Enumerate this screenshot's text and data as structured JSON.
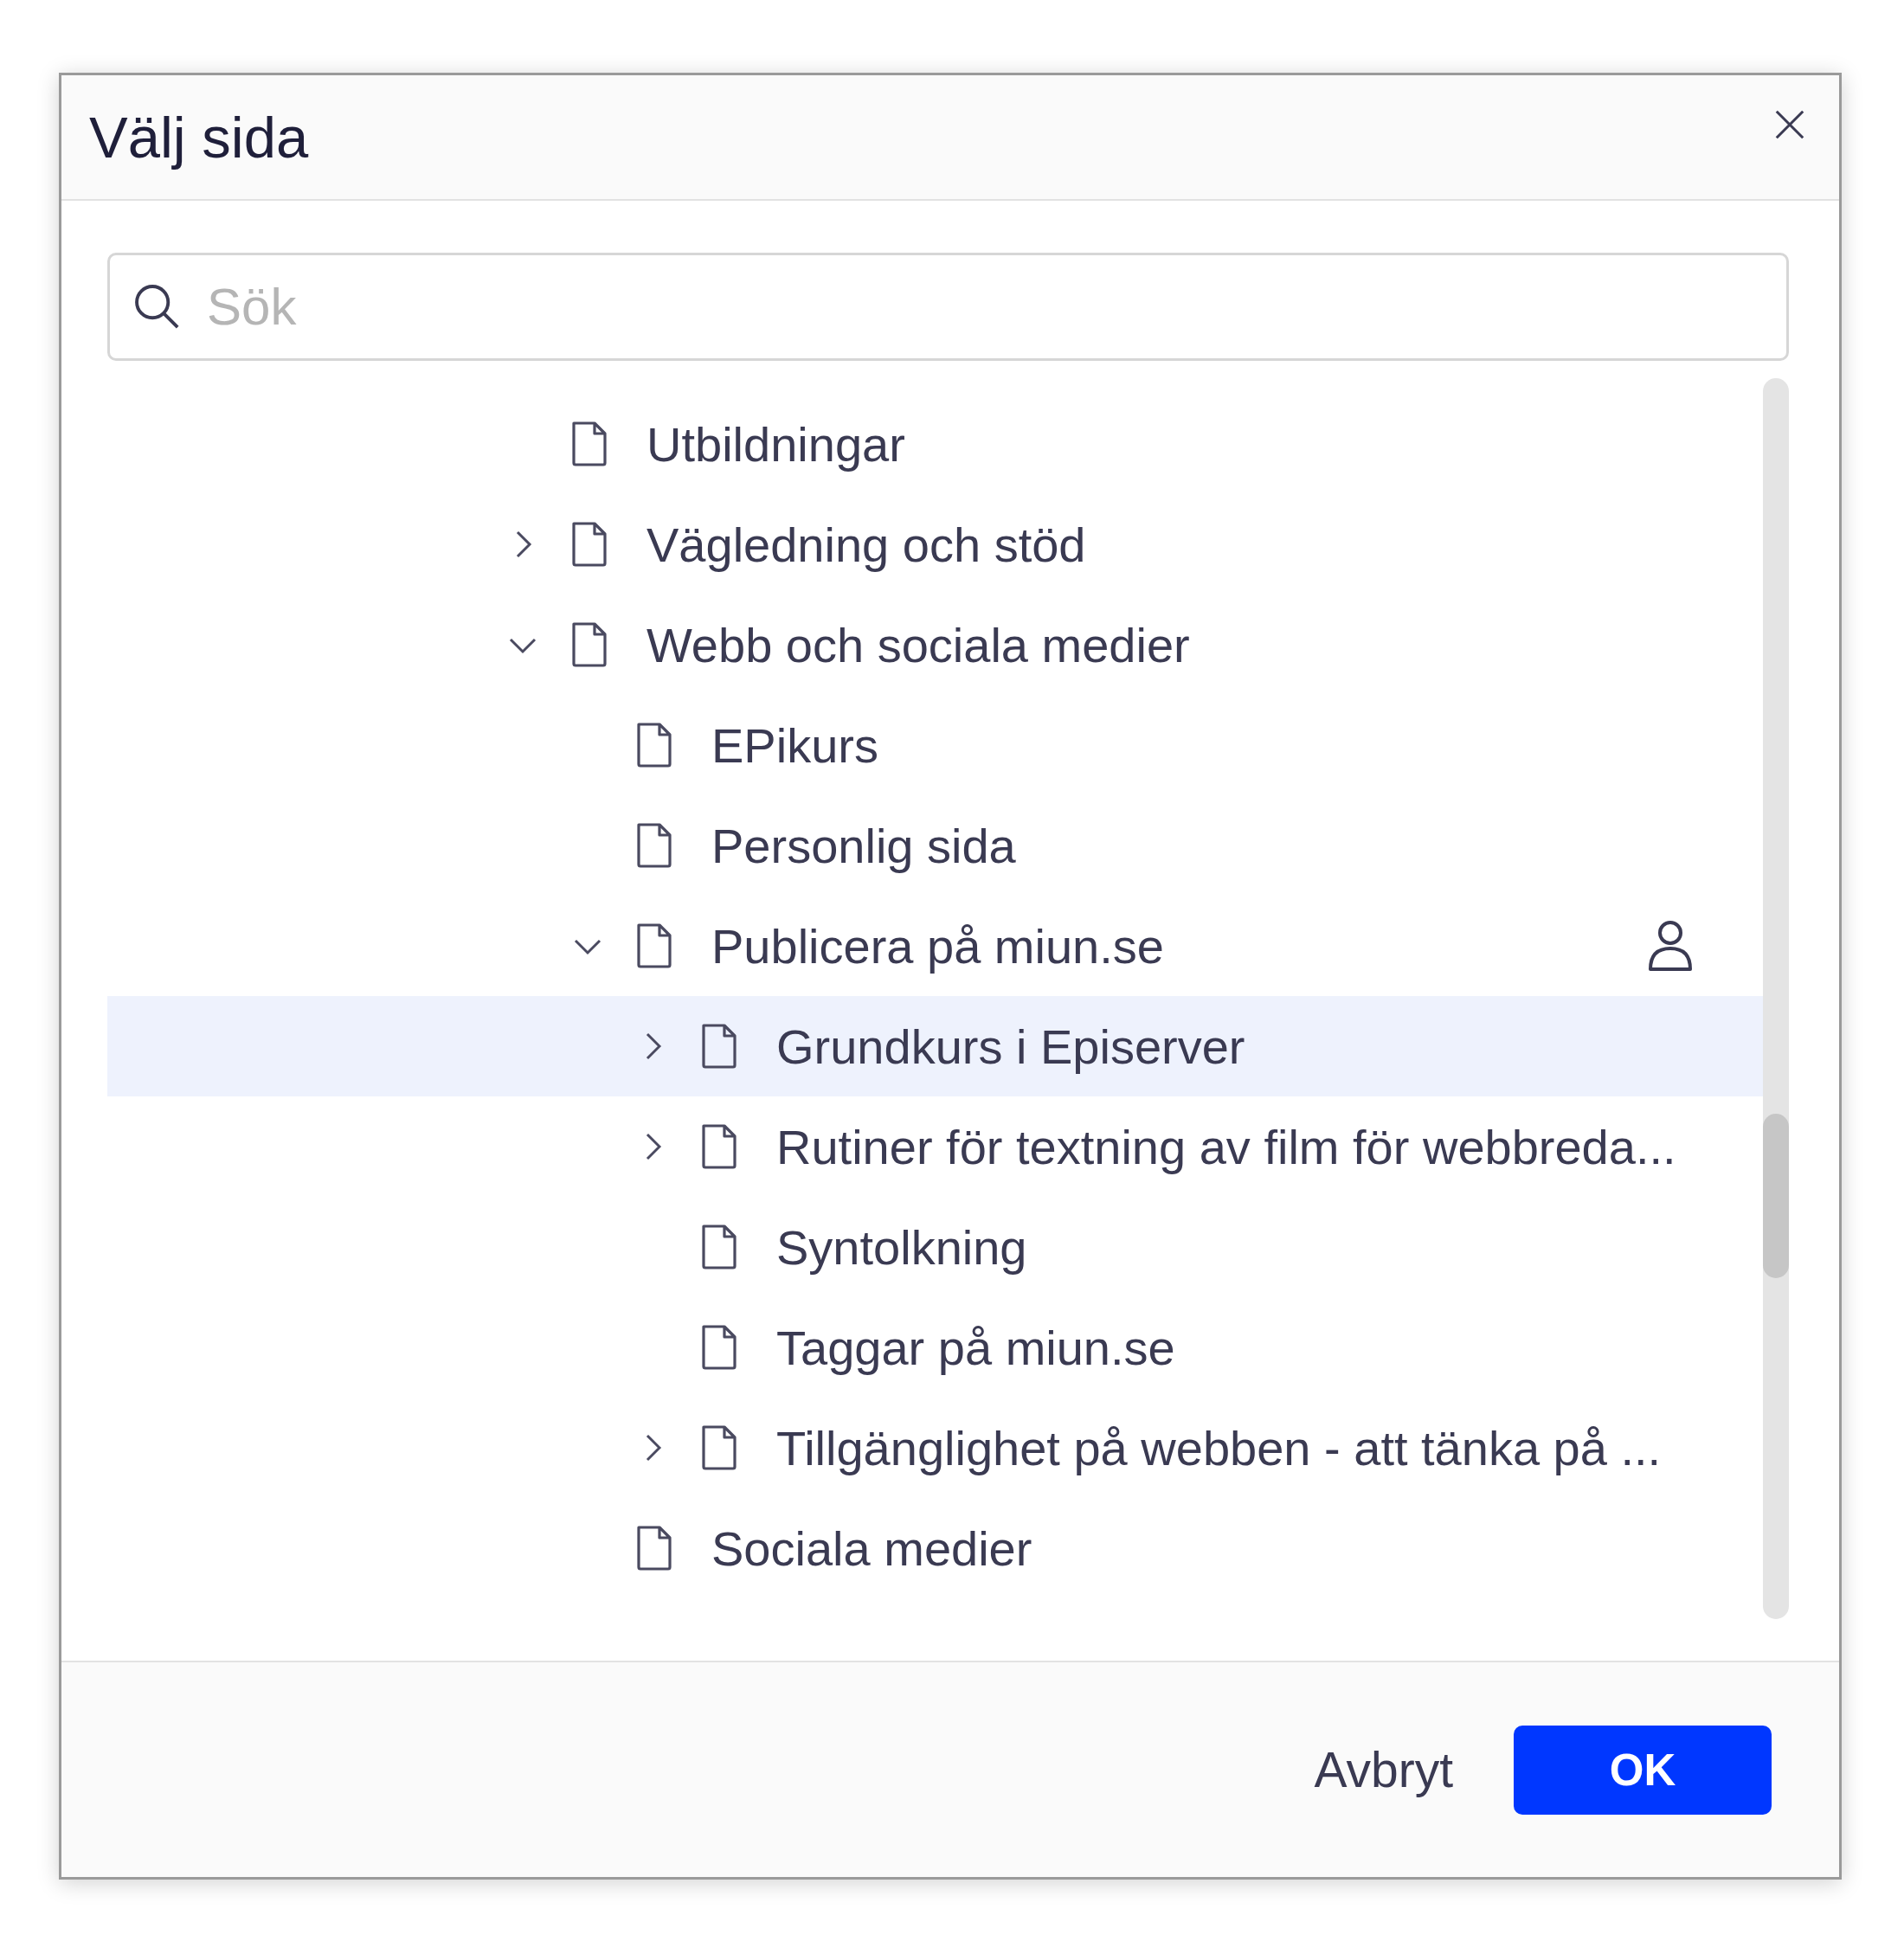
{
  "dialog": {
    "title": "Välj sida"
  },
  "search": {
    "placeholder": "Sök"
  },
  "tree": [
    {
      "label": "Utbildningar",
      "selected": false
    },
    {
      "label": "Vägledning och stöd",
      "expanded": false,
      "selected": false
    },
    {
      "label": "Webb och sociala medier",
      "expanded": true,
      "selected": false,
      "children": [
        {
          "label": "EPikurs",
          "selected": false
        },
        {
          "label": "Personlig sida",
          "selected": false
        },
        {
          "label": "Publicera på miun.se",
          "expanded": true,
          "selected": false,
          "user_marker": true,
          "children": [
            {
              "label": "Grundkurs i Episerver",
              "expanded": false,
              "selected": true
            },
            {
              "label": "Rutiner för textning av film för webbreda...",
              "expanded": false,
              "selected": false
            },
            {
              "label": "Syntolkning",
              "selected": false
            },
            {
              "label": "Taggar på miun.se",
              "selected": false
            },
            {
              "label": "Tillgänglighet på webben - att tänka på ...",
              "expanded": false,
              "selected": false
            }
          ]
        },
        {
          "label": "Sociala medier",
          "selected": false
        }
      ]
    }
  ],
  "buttons": [
    {
      "label": "Avbryt",
      "kind": "secondary"
    },
    {
      "label": "OK",
      "kind": "primary"
    }
  ]
}
